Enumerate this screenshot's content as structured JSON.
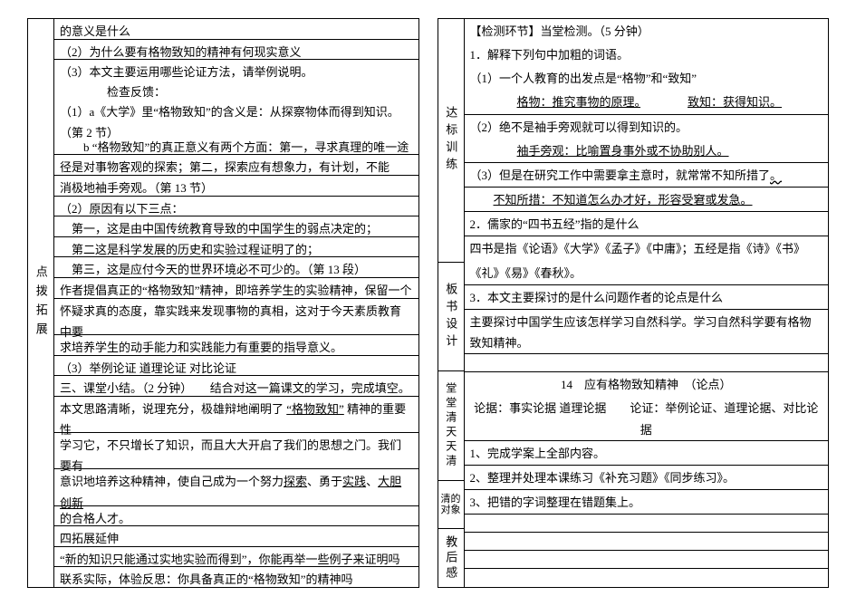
{
  "left": {
    "side_label": "点拨拓展",
    "lines": [
      "的意义是什么",
      "（2）为什么要有格物致知的精神有何现实意义",
      "（3）本文主要运用哪些论证方法，请举例说明。",
      "　　　　检查反馈：",
      "（1）a《大学》里“格物致知”的含义是：从探察物体而得到知识。（第 2 节）",
      "　　b “格物致知”的真正意义有两个方面：第一，寻求真理的唯一途",
      "径是对事物客观的探索；第二，探索应有想象力，有计划，不能",
      "消极地袖手旁观。（第 13 节）",
      "（2）原因有以下三点：",
      "　第一，这是由中国传统教育导致的中国学生的弱点决定的；",
      "　第二这是科学发展的历史和实验过程证明了的；",
      "　第三，这是应付今天的世界环境必不可少的。（第 13 段）",
      "作者提倡真正的“格物致知”精神，即培养学生的实验精神，保留一个",
      "怀疑求真的态度，靠实践来发现事物的真相，这对于今天素质教育中要",
      "求培养学生的动手能力和实践能力有重要的指导意义。",
      "（3）举例论证  道理论证  对比论证",
      "三、课堂小结。（2 分钟）　　结合对这一篇课文的学习，完成填空。"
    ],
    "summary_lines": [
      "本文思路清晰，说理充分，极雄辩地阐明了",
      "精神的重要性",
      "学习它，不只增长了知识，而且大大开启了我们的思想之门。我们要有",
      "意识地培养这种精神，使自己成为一个努力",
      "、勇于",
      "、",
      "的合格人才。"
    ],
    "blank1": "“格物致知”",
    "blank2": "探索",
    "blank3": "实践",
    "blank4": "大胆创新",
    "after": [
      "四拓展延伸",
      "“新的知识只能通过实地实验而得到”，你能再举一些例子来证明吗",
      "联系实际，体验反思：你具备真正的“格物致知”的精神吗"
    ]
  },
  "right": {
    "sections": [
      {
        "label": "达标训练",
        "lines": [
          "【检测环节】当堂检测。（5 分钟）",
          "1．解释下列句中加粗的词语。",
          "（1）一个人教育的出发点是“格物”和“致知”",
          "",
          "（2）绝不是袖手旁观就可以得到知识的。",
          "",
          "（3）但是在研究工作中需要拿主意时，就常常不知所措了",
          "",
          "2．儒家的“四书五经”指的是什么",
          "四书是指《论语》《大学》《孟子》《中庸》；五经是指《诗》《书》",
          "《礼》《易》《春秋》。",
          "3．本文主要探讨的是什么问题作者的论点是什么"
        ],
        "ans1a": "格物：推究事物的原理。",
        "ans1b": "致知：获得知识。",
        "ans2": "袖手旁观：比喻置身事外或不协助别人。",
        "ans3": "不知所措：不知道怎么办才好，形容受窘或发急。"
      },
      {
        "label": "板书设计",
        "lines": [
          "主要探讨中国学生应该怎样学习自然科学。学习自然科学要有格物致知精神。",
          "",
          "14　应有格物致知精神　（论点）",
          "论据：事实论据  道理论据　　论证：举例论证、道理论据、对比论据"
        ]
      },
      {
        "label": "堂堂清天天清",
        "lines": [
          "1、完成学案上全部内容。",
          "2、整理并处理本课练习《补充习题》《同步练习》。",
          "3、把错的字词整理在错题集上。",
          ""
        ]
      },
      {
        "label": "清的对象",
        "lines": [
          ""
        ]
      },
      {
        "label": "教后感",
        "lines": [
          "",
          ""
        ]
      }
    ]
  }
}
